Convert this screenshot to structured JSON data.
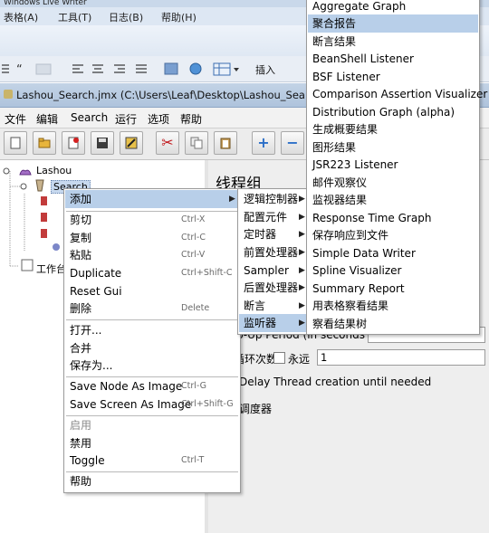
{
  "background_app": {
    "title": "Windows Live Writer",
    "menu": [
      "表格(A)",
      "工具(T)",
      "日志(B)",
      "帮助(H)"
    ],
    "toolbar_insert": "插入"
  },
  "window": {
    "title": "Lashou_Search.jmx (C:\\Users\\Leaf\\Desktop\\Lashou_Search.jmx) - Apache JMeter"
  },
  "menubar": [
    "文件",
    "编辑",
    "Search",
    "运行",
    "选项",
    "帮助"
  ],
  "toolbar_glyphs": {
    "cut": "✂",
    "plus": "+",
    "minus": "−"
  },
  "tree": {
    "root": "Lashou",
    "child": "Search",
    "workbench": "工作台"
  },
  "panel": {
    "heading": "线程组",
    "rampup": "Ramp-Up Period (in seconds):",
    "loop_label": "循环次数",
    "forever": "永远",
    "loop_value": "1",
    "delay": "Delay Thread creation until needed",
    "scheduler": "调度器"
  },
  "context_menu": {
    "add": "添加",
    "cut": "剪切",
    "cut_sc": "Ctrl-X",
    "copy": "复制",
    "copy_sc": "Ctrl-C",
    "paste": "粘贴",
    "paste_sc": "Ctrl-V",
    "duplicate": "Duplicate",
    "duplicate_sc": "Ctrl+Shift-C",
    "reset_gui": "Reset Gui",
    "delete": "删除",
    "delete_sc": "Delete",
    "open": "打开...",
    "merge": "合并",
    "save_as": "保存为...",
    "save_node_image": "Save Node As Image",
    "save_node_image_sc": "Ctrl-G",
    "save_screen_image": "Save Screen As Image",
    "save_screen_image_sc": "Ctrl+Shift-G",
    "enable": "启用",
    "disable": "禁用",
    "toggle": "Toggle",
    "toggle_sc": "Ctrl-T",
    "help": "帮助"
  },
  "add_submenu": [
    "逻辑控制器",
    "配置元件",
    "定时器",
    "前置处理器",
    "Sampler",
    "后置处理器",
    "断言",
    "监听器"
  ],
  "listener_submenu": [
    "Aggregate Graph",
    "聚合报告",
    "断言结果",
    "BeanShell Listener",
    "BSF Listener",
    "Comparison Assertion Visualizer",
    "Distribution Graph (alpha)",
    "生成概要结果",
    "图形结果",
    "JSR223 Listener",
    "邮件观察仪",
    "监视器结果",
    "Response Time Graph",
    "保存响应到文件",
    "Simple Data Writer",
    "Spline Visualizer",
    "Summary Report",
    "用表格察看结果",
    "察看结果树"
  ]
}
